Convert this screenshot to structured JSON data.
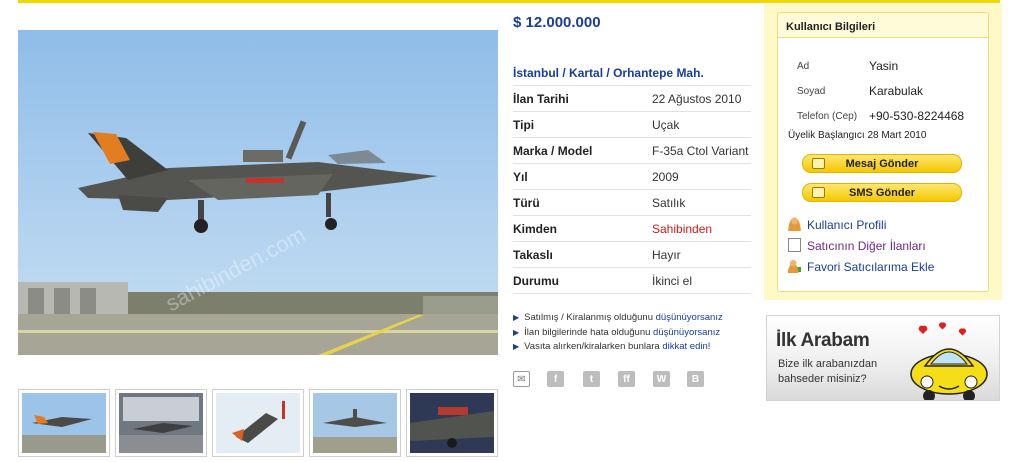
{
  "listing": {
    "price": "$ 12.000.000",
    "location": {
      "city": "İstanbul",
      "district": "Kartal",
      "neighborhood": "Orhantepe Mah.",
      "sep": "/"
    },
    "details": [
      {
        "label": "İlan Tarihi",
        "value": "22 Ağustos 2010"
      },
      {
        "label": "Tipi",
        "value": "Uçak"
      },
      {
        "label": "Marka / Model",
        "value": "F-35a Ctol Variant"
      },
      {
        "label": "Yıl",
        "value": "2009"
      },
      {
        "label": "Türü",
        "value": "Satılık"
      },
      {
        "label": "Kimden",
        "value": "Sahibinden"
      },
      {
        "label": "Takaslı",
        "value": "Hayır"
      },
      {
        "label": "Durumu",
        "value": "İkinci el"
      }
    ],
    "notes": [
      {
        "text": "Satılmış / Kiralanmış olduğunu ",
        "link": "düşünüyorsanız"
      },
      {
        "text": "İlan bilgilerinde hata olduğunu ",
        "link": "düşünüyorsanız"
      },
      {
        "text": "Vasıta alırken/kiralarken bunlara ",
        "link": "dikkat edin!"
      }
    ],
    "share_icons": [
      "email-icon",
      "facebook-icon",
      "twitter-icon",
      "friendfeed-icon",
      "wordpress-icon",
      "blogger-icon"
    ]
  },
  "user": {
    "title": "Kullanıcı Bilgileri",
    "name_label": "Ad",
    "name": "Yasin",
    "surname_label": "Soyad",
    "surname": "Karabulak",
    "phone_label": "Telefon (Cep)",
    "phone": "+90-530-8224468",
    "member_since": "Üyelik Başlangıcı 28 Mart 2010",
    "buttons": {
      "message": "Mesaj Gönder",
      "sms": "SMS Gönder"
    },
    "links": {
      "profile": "Kullanıcı Profili",
      "other_listings": "Satıcının Diğer İlanları",
      "favorite": "Favori Satıcılarıma Ekle"
    }
  },
  "ad": {
    "title": "İlk Arabam",
    "text": "Bize ilk arabanızdan bahseder misiniz?"
  },
  "colors": {
    "accent_yellow": "#f2d800",
    "link_blue": "#1a3c9a",
    "red": "#cc1c1c"
  }
}
